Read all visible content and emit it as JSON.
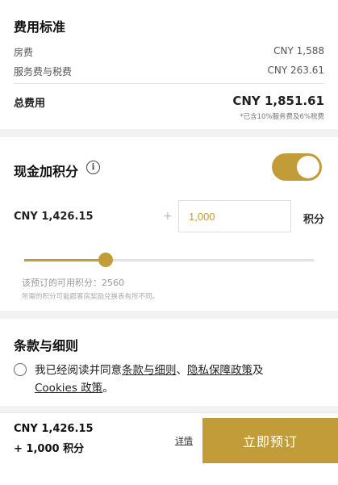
{
  "fees": {
    "title": "费用标准",
    "room_label": "房费",
    "room_value": "CNY 1,588",
    "tax_label": "服务费与税费",
    "tax_value": "CNY 263.61",
    "total_label": "总费用",
    "total_value": "CNY 1,851.61",
    "total_note": "*已含10%服务费及6%税费"
  },
  "mixed_payment": {
    "title": "现金加积分",
    "info_icon": "i",
    "toggle_on": true,
    "cash_amount": "CNY 1,426.15",
    "plus_sign": "+",
    "points_value": "1,000",
    "points_unit": "积分",
    "slider_fraction": 0.28,
    "available_points_text": "该预订的可用积分：2560",
    "points_note": "所需的积分可能跟客房奖励兑换表有所不同。"
  },
  "terms": {
    "title": "条款与细则",
    "text_prefix": "我已经阅读并同意",
    "link_terms": "条款与细则",
    "sep": "、",
    "link_privacy": "隐私保障政策",
    "and": "及",
    "link_cookies": "Cookies 政策",
    "suffix": "。"
  },
  "footer": {
    "price": "CNY 1,426.15",
    "points": "+ 1,000 积分",
    "details_label": "详情",
    "book_label": "立即预订"
  },
  "colors": {
    "accent": "#c39c3a",
    "background": "#f2f2f2"
  }
}
